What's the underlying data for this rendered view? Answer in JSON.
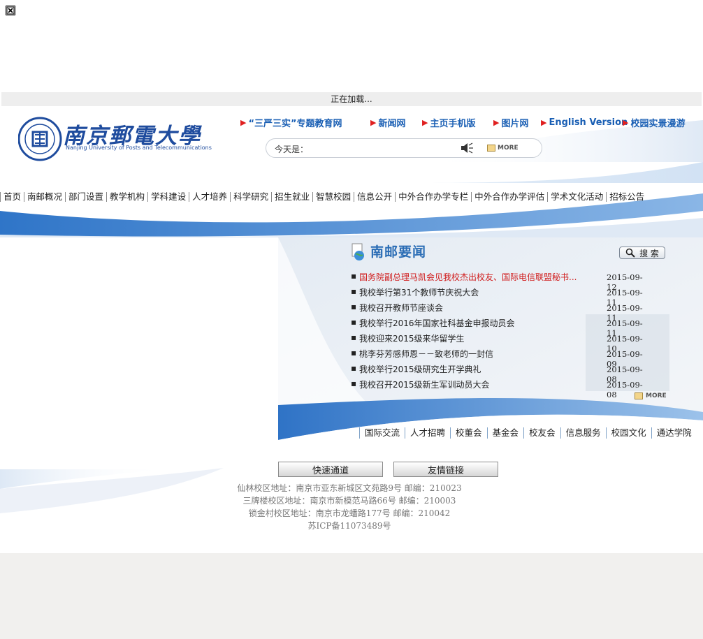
{
  "loading_text": "正在加载...",
  "logo": {
    "name_cn": "南京郵電大學",
    "name_en": "Nanjing University of Posts and Telecommunications",
    "seal_text": "南京郵電大學"
  },
  "top_links": [
    {
      "label": "“三严三实”专题教育网"
    },
    {
      "label": "新闻网"
    },
    {
      "label": "主页手机版"
    },
    {
      "label": "图片网"
    },
    {
      "label": "English Version"
    },
    {
      "label": "校园实景漫游"
    }
  ],
  "search": {
    "today_label": "今天是：",
    "more_label": "MORE"
  },
  "nav": [
    "首页",
    "南邮概况",
    "部门设置",
    "教学机构",
    "学科建设",
    "人才培养",
    "科学研究",
    "招生就业",
    "智慧校园",
    "信息公开",
    "中外合作办学专栏",
    "中外合作办学评估",
    "学术文化活动",
    "招标公告"
  ],
  "news": {
    "title": "南邮要闻",
    "search_button": "搜 索",
    "more_label": "MORE",
    "items": [
      {
        "title": "国务院副总理马凯会见我校杰出校友、国际电信联盟秘书...",
        "date": "2015-09-12",
        "highlight": true
      },
      {
        "title": "我校举行第31个教师节庆祝大会",
        "date": "2015-09-11",
        "highlight": false
      },
      {
        "title": "我校召开教师节座谈会",
        "date": "2015-09-11",
        "highlight": false
      },
      {
        "title": "我校举行2016年国家社科基金申报动员会",
        "date": "2015-09-11",
        "highlight": false
      },
      {
        "title": "我校迎来2015级来华留学生",
        "date": "2015-09-10",
        "highlight": false
      },
      {
        "title": "桃李芬芳感师恩－－致老师的一封信",
        "date": "2015-09-09",
        "highlight": false
      },
      {
        "title": "我校举行2015级研究生开学典礼",
        "date": "2015-09-08",
        "highlight": false
      },
      {
        "title": "我校召开2015级新生军训动员大会",
        "date": "2015-09-08",
        "highlight": false
      }
    ]
  },
  "sub_links": [
    "国际交流",
    "人才招聘",
    "校董会",
    "基金会",
    "校友会",
    "信息服务",
    "校园文化",
    "通达学院"
  ],
  "footer": {
    "quick_access": "快速通道",
    "friend_links": "友情链接",
    "address_lines": [
      "仙林校区地址：南京市亚东新城区文苑路9号  邮编：210023",
      "三牌楼校区地址：南京市新模范马路66号  邮编：210003",
      "锁金村校区地址：南京市龙蟠路177号  邮编：210042",
      "苏ICP备11073489号"
    ]
  },
  "colors": {
    "accent": "#2b6db5",
    "highlight": "#d01a1a",
    "link_triangle": "#e02020",
    "swoosh": "#3a7ecf"
  },
  "icons": [
    "broken-image-icon",
    "university-seal-icon",
    "speaker-icon",
    "more-badge-icon",
    "news-globe-icon",
    "magnifier-icon"
  ]
}
